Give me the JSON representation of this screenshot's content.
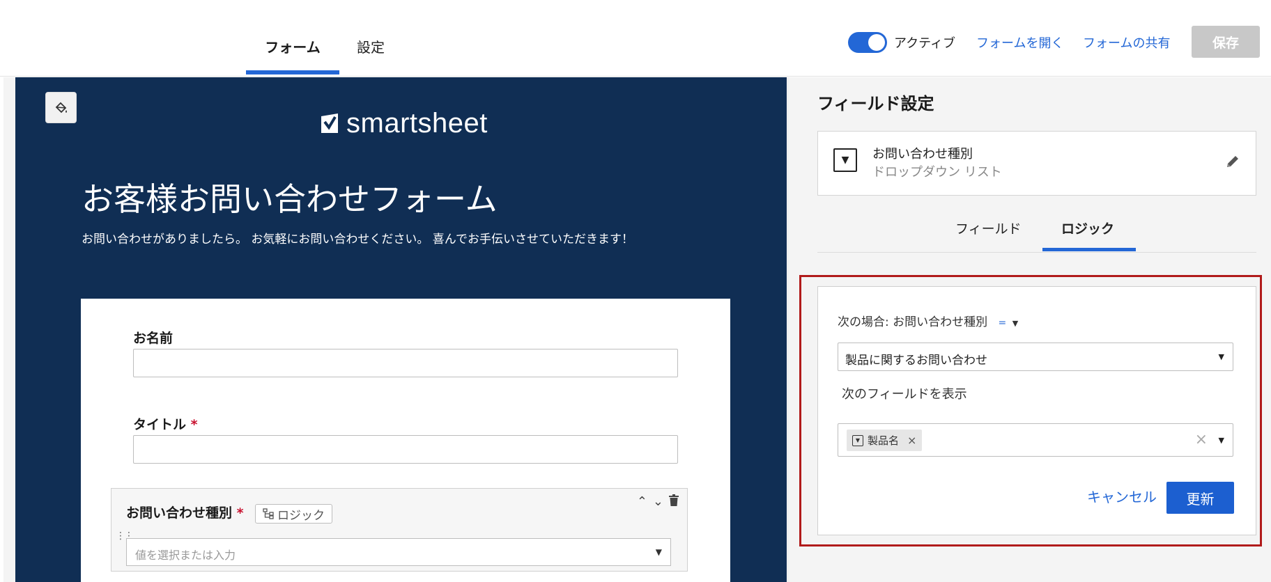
{
  "header": {
    "tabs": [
      {
        "label": "フォーム",
        "active": true
      },
      {
        "label": "設定",
        "active": false
      }
    ],
    "toggle_label": "アクティブ",
    "toggle_on": true,
    "open_form": "フォームを開く",
    "share_form": "フォームの共有",
    "save_label": "保存"
  },
  "form": {
    "logo_text": "smartsheet",
    "title": "お客様お問い合わせフォーム",
    "description": "お問い合わせがありましたら。 お気軽にお問い合わせください。 喜んでお手伝いさせていただきます！",
    "fields": [
      {
        "label": "お名前",
        "required": false
      },
      {
        "label": "タイトル",
        "required": true,
        "required_mark": "*"
      },
      {
        "label": "お問い合わせ種別",
        "required": true,
        "required_mark": "*",
        "logic_chip": "ロジック",
        "placeholder": "値を選択または入力"
      }
    ]
  },
  "panel": {
    "title": "フィールド設定",
    "field_name": "お問い合わせ種別",
    "field_type": "ドロップダウン リスト",
    "tabs": [
      {
        "label": "フィールド",
        "active": false
      },
      {
        "label": "ロジック",
        "active": true
      }
    ],
    "logic": {
      "condition_prefix": "次の場合: お問い合わせ種別",
      "operator": "=",
      "value": "製品に関するお問い合わせ",
      "show_label": "次のフィールドを表示",
      "selected_fields": [
        "製品名"
      ],
      "cancel_label": "キャンセル",
      "update_label": "更新"
    }
  },
  "colors": {
    "accent": "#2367d6",
    "form_background": "#102e54",
    "highlight": "#b11b1b"
  }
}
